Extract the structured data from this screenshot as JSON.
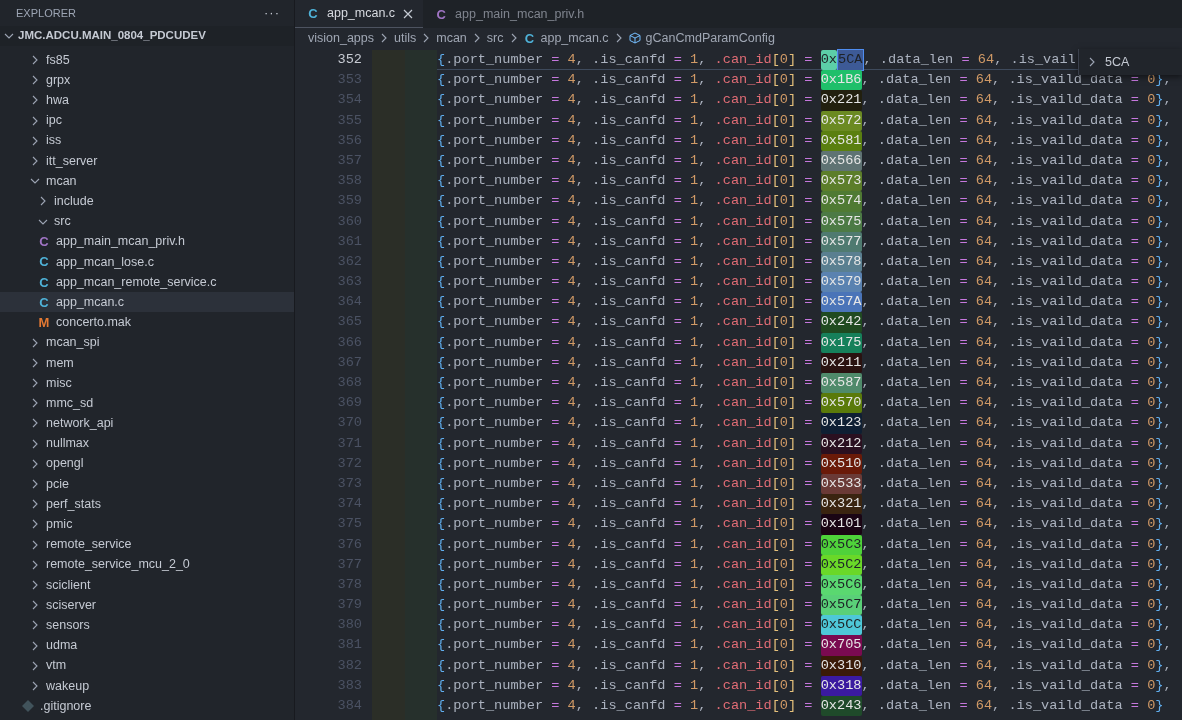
{
  "sidebar": {
    "title": "EXPLORER",
    "more": "···",
    "root": {
      "label": "JMC.ADCU.MAIN_0804_PDCUDEV",
      "expanded": true,
      "children": [
        {
          "kind": "folder",
          "label": "fs85",
          "expanded": false
        },
        {
          "kind": "folder",
          "label": "grpx",
          "expanded": false
        },
        {
          "kind": "folder",
          "label": "hwa",
          "expanded": false
        },
        {
          "kind": "folder",
          "label": "ipc",
          "expanded": false
        },
        {
          "kind": "folder",
          "label": "iss",
          "expanded": false
        },
        {
          "kind": "folder",
          "label": "itt_server",
          "expanded": false
        },
        {
          "kind": "folder",
          "label": "mcan",
          "expanded": true,
          "children": [
            {
              "kind": "folder",
              "label": "include",
              "expanded": false
            },
            {
              "kind": "folder",
              "label": "src",
              "expanded": true,
              "children": [
                {
                  "kind": "h",
                  "icon": "C",
                  "label": "app_main_mcan_priv.h",
                  "selected": false
                },
                {
                  "kind": "c",
                  "icon": "C",
                  "label": "app_mcan_lose.c",
                  "selected": false
                },
                {
                  "kind": "c",
                  "icon": "C",
                  "label": "app_mcan_remote_service.c",
                  "selected": false
                },
                {
                  "kind": "c",
                  "icon": "C",
                  "label": "app_mcan.c",
                  "selected": true
                },
                {
                  "kind": "make",
                  "icon": "M",
                  "label": "concerto.mak",
                  "selected": false
                }
              ]
            }
          ]
        },
        {
          "kind": "folder",
          "label": "mcan_spi",
          "expanded": false
        },
        {
          "kind": "folder",
          "label": "mem",
          "expanded": false
        },
        {
          "kind": "folder",
          "label": "misc",
          "expanded": false
        },
        {
          "kind": "folder",
          "label": "mmc_sd",
          "expanded": false
        },
        {
          "kind": "folder",
          "label": "network_api",
          "expanded": false
        },
        {
          "kind": "folder",
          "label": "nullmax",
          "expanded": false
        },
        {
          "kind": "folder",
          "label": "opengl",
          "expanded": false
        },
        {
          "kind": "folder",
          "label": "pcie",
          "expanded": false
        },
        {
          "kind": "folder",
          "label": "perf_stats",
          "expanded": false
        },
        {
          "kind": "folder",
          "label": "pmic",
          "expanded": false
        },
        {
          "kind": "folder",
          "label": "remote_service",
          "expanded": false
        },
        {
          "kind": "folder",
          "label": "remote_service_mcu_2_0",
          "expanded": false
        },
        {
          "kind": "folder",
          "label": "sciclient",
          "expanded": false
        },
        {
          "kind": "folder",
          "label": "sciserver",
          "expanded": false
        },
        {
          "kind": "folder",
          "label": "sensors",
          "expanded": false
        },
        {
          "kind": "folder",
          "label": "udma",
          "expanded": false
        },
        {
          "kind": "folder",
          "label": "vtm",
          "expanded": false
        },
        {
          "kind": "folder",
          "label": "wakeup",
          "expanded": false
        },
        {
          "kind": "git",
          "label": ".gitignore",
          "selected": false
        }
      ]
    }
  },
  "tabs": [
    {
      "kind": "c",
      "icon": "C",
      "label": "app_mcan.c",
      "selected": true
    },
    {
      "kind": "h",
      "icon": "C",
      "label": "app_main_mcan_priv.h",
      "selected": false
    }
  ],
  "breadcrumb": [
    {
      "kind": "folder",
      "label": "vision_apps"
    },
    {
      "kind": "folder",
      "label": "utils"
    },
    {
      "kind": "folder",
      "label": "mcan"
    },
    {
      "kind": "folder",
      "label": "src"
    },
    {
      "kind": "c",
      "icon": "C",
      "label": "app_mcan.c"
    },
    {
      "kind": "symbol",
      "label": "gCanCmdParamConfig"
    }
  ],
  "code": {
    "lines": [
      {
        "number": "352",
        "current": true,
        "before": "{.port_number = 4, .is_canfd = 1, .can_id[0] = ",
        "can_id": "0x",
        "match": "5CA",
        "color": "#5ccfa8",
        "after": ", .data_len = 64, .is_vail"
      },
      {
        "number": "353",
        "current": false,
        "before": "{.port_number = 4, .is_canfd = 1, .can_id[0] = ",
        "can_id": "0x1B6",
        "color": "#1fbf6a",
        "after": ", .data_len = 64, .is_vaild_data = 0},"
      },
      {
        "number": "354",
        "current": false,
        "before": "{.port_number = 4, .is_canfd = 1, .can_id[0] = ",
        "can_id": "0x221",
        "color": "#22200f",
        "after": ", .data_len = 64, .is_vaild_data = 0},"
      },
      {
        "number": "355",
        "current": false,
        "before": "{.port_number = 4, .is_canfd = 1, .can_id[0] = ",
        "can_id": "0x572",
        "color": "#6b8a22",
        "after": ", .data_len = 64, .is_vaild_data = 0},"
      },
      {
        "number": "356",
        "current": false,
        "before": "{.port_number = 4, .is_canfd = 1, .can_id[0] = ",
        "can_id": "0x581",
        "color": "#5a7f10",
        "after": ", .data_len = 64, .is_vaild_data = 0},"
      },
      {
        "number": "357",
        "current": false,
        "before": "{.port_number = 4, .is_canfd = 1, .can_id[0] = ",
        "can_id": "0x566",
        "color": "#5f7373",
        "after": ", .data_len = 64, .is_vaild_data = 0},"
      },
      {
        "number": "358",
        "current": false,
        "before": "{.port_number = 4, .is_canfd = 1, .can_id[0] = ",
        "can_id": "0x573",
        "color": "#5c7e2a",
        "after": ", .data_len = 64, .is_vaild_data = 0},"
      },
      {
        "number": "359",
        "current": false,
        "before": "{.port_number = 4, .is_canfd = 1, .can_id[0] = ",
        "can_id": "0x574",
        "color": "#4f7a33",
        "after": ", .data_len = 64, .is_vaild_data = 0},"
      },
      {
        "number": "360",
        "current": false,
        "before": "{.port_number = 4, .is_canfd = 1, .can_id[0] = ",
        "can_id": "0x575",
        "color": "#4c7a45",
        "after": ", .data_len = 64, .is_vaild_data = 0},"
      },
      {
        "number": "361",
        "current": false,
        "before": "{.port_number = 4, .is_canfd = 1, .can_id[0] = ",
        "can_id": "0x577",
        "color": "#4f7a70",
        "after": ", .data_len = 64, .is_vaild_data = 0},"
      },
      {
        "number": "362",
        "current": false,
        "before": "{.port_number = 4, .is_canfd = 1, .can_id[0] = ",
        "can_id": "0x578",
        "color": "#5a7f90",
        "after": ", .data_len = 64, .is_vaild_data = 0},"
      },
      {
        "number": "363",
        "current": false,
        "before": "{.port_number = 4, .is_canfd = 1, .can_id[0] = ",
        "can_id": "0x579",
        "color": "#5a82b0",
        "after": ", .data_len = 64, .is_vaild_data = 0},"
      },
      {
        "number": "364",
        "current": false,
        "before": "{.port_number = 4, .is_canfd = 1, .can_id[0] = ",
        "can_id": "0x57A",
        "color": "#4a74b8",
        "after": ", .data_len = 64, .is_vaild_data = 0},"
      },
      {
        "number": "365",
        "current": false,
        "before": "{.port_number = 4, .is_canfd = 1, .can_id[0] = ",
        "can_id": "0x242",
        "color": "#204a20",
        "after": ", .data_len = 64, .is_vaild_data = 0},"
      },
      {
        "number": "366",
        "current": false,
        "before": "{.port_number = 4, .is_canfd = 1, .can_id[0] = ",
        "can_id": "0x175",
        "color": "#16805a",
        "after": ", .data_len = 64, .is_vaild_data = 0},"
      },
      {
        "number": "367",
        "current": false,
        "before": "{.port_number = 4, .is_canfd = 1, .can_id[0] = ",
        "can_id": "0x211",
        "color": "#2a1210",
        "after": ", .data_len = 64, .is_vaild_data = 0},"
      },
      {
        "number": "368",
        "current": false,
        "before": "{.port_number = 4, .is_canfd = 1, .can_id[0] = ",
        "can_id": "0x587",
        "color": "#4f8a6a",
        "after": ", .data_len = 64, .is_vaild_data = 0},"
      },
      {
        "number": "369",
        "current": false,
        "before": "{.port_number = 4, .is_canfd = 1, .can_id[0] = ",
        "can_id": "0x570",
        "color": "#5a7a0a",
        "after": ", .data_len = 64, .is_vaild_data = 0},"
      },
      {
        "number": "370",
        "current": false,
        "before": "{.port_number = 4, .is_canfd = 1, .can_id[0] = ",
        "can_id": "0x123",
        "color": "#0f1f33",
        "after": ", .data_len = 64, .is_vaild_data = 0},"
      },
      {
        "number": "371",
        "current": false,
        "before": "{.port_number = 4, .is_canfd = 1, .can_id[0] = ",
        "can_id": "0x212",
        "color": "#2a1020",
        "after": ", .data_len = 64, .is_vaild_data = 0},"
      },
      {
        "number": "372",
        "current": false,
        "before": "{.port_number = 4, .is_canfd = 1, .can_id[0] = ",
        "can_id": "0x510",
        "color": "#6a1a08",
        "after": ", .data_len = 64, .is_vaild_data = 0},"
      },
      {
        "number": "373",
        "current": false,
        "before": "{.port_number = 4, .is_canfd = 1, .can_id[0] = ",
        "can_id": "0x533",
        "color": "#6a3a36",
        "after": ", .data_len = 64, .is_vaild_data = 0},"
      },
      {
        "number": "374",
        "current": false,
        "before": "{.port_number = 4, .is_canfd = 1, .can_id[0] = ",
        "can_id": "0x321",
        "color": "#3a2410",
        "after": ", .data_len = 64, .is_vaild_data = 0},"
      },
      {
        "number": "375",
        "current": false,
        "before": "{.port_number = 4, .is_canfd = 1, .can_id[0] = ",
        "can_id": "0x101",
        "color": "#1a0514",
        "after": ", .data_len = 64, .is_vaild_data = 0},"
      },
      {
        "number": "376",
        "current": false,
        "before": "{.port_number = 4, .is_canfd = 1, .can_id[0] = ",
        "can_id": "0x5C3",
        "color": "#4fd23a",
        "after": ", .data_len = 64, .is_vaild_data = 0},"
      },
      {
        "number": "377",
        "current": false,
        "before": "{.port_number = 4, .is_canfd = 1, .can_id[0] = ",
        "can_id": "0x5C2",
        "color": "#6ad828",
        "after": ", .data_len = 64, .is_vaild_data = 0},"
      },
      {
        "number": "378",
        "current": false,
        "before": "{.port_number = 4, .is_canfd = 1, .can_id[0] = ",
        "can_id": "0x5C6",
        "color": "#5ad870",
        "after": ", .data_len = 64, .is_vaild_data = 0},"
      },
      {
        "number": "379",
        "current": false,
        "before": "{.port_number = 4, .is_canfd = 1, .can_id[0] = ",
        "can_id": "0x5C7",
        "color": "#5ad078",
        "after": ", .data_len = 64, .is_vaild_data = 0},"
      },
      {
        "number": "380",
        "current": false,
        "before": "{.port_number = 4, .is_canfd = 1, .can_id[0] = ",
        "can_id": "0x5CC",
        "color": "#4ec8d8",
        "after": ", .data_len = 64, .is_vaild_data = 0},"
      },
      {
        "number": "381",
        "current": false,
        "before": "{.port_number = 4, .is_canfd = 1, .can_id[0] = ",
        "can_id": "0x705",
        "color": "#7a0a50",
        "after": ", .data_len = 64, .is_vaild_data = 0},"
      },
      {
        "number": "382",
        "current": false,
        "before": "{.port_number = 4, .is_canfd = 1, .can_id[0] = ",
        "can_id": "0x310",
        "color": "#3a1a08",
        "after": ", .data_len = 64, .is_vaild_data = 0},"
      },
      {
        "number": "383",
        "current": false,
        "before": "{.port_number = 4, .is_canfd = 1, .can_id[0] = ",
        "can_id": "0x318",
        "color": "#3a1aa0",
        "after": ", .data_len = 64, .is_vaild_data = 0},"
      },
      {
        "number": "384",
        "current": false,
        "before": "{.port_number = 4, .is_canfd = 1, .can_id[0] = ",
        "can_id": "0x243",
        "color": "#1f4a2a",
        "after": ", .data_len = 64, .is_vaild_data = 0}"
      }
    ]
  },
  "find_widget": {
    "value": "5CA"
  }
}
